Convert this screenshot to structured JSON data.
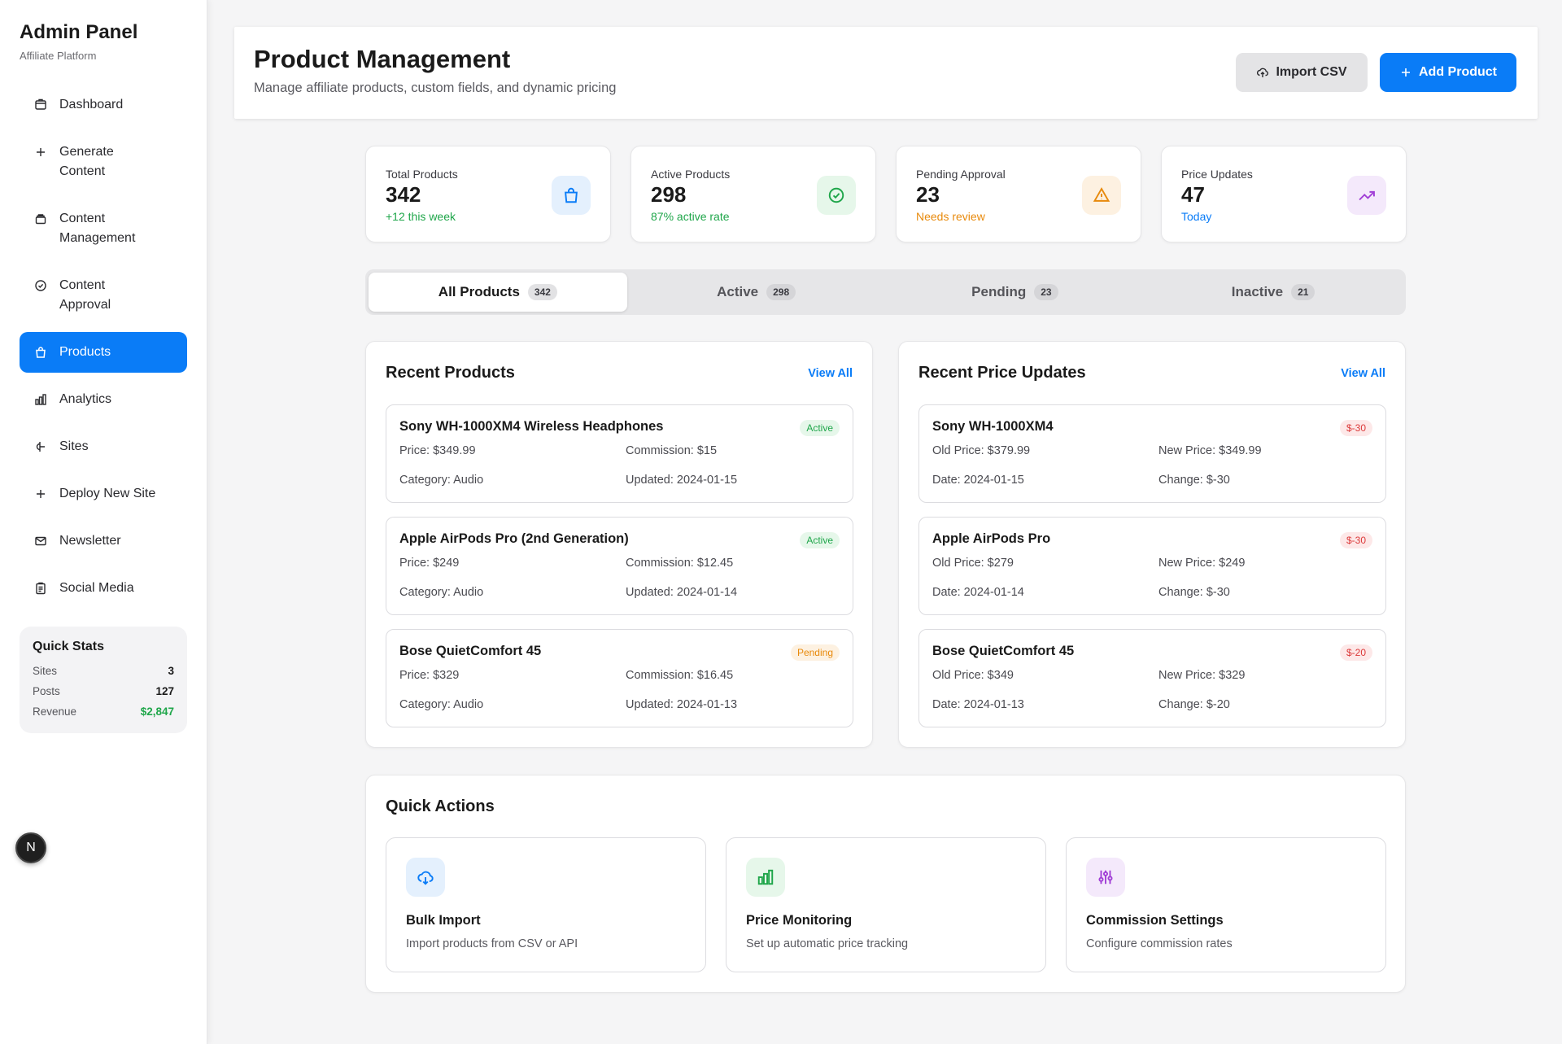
{
  "sidebar": {
    "title": "Admin Panel",
    "subtitle": "Affiliate Platform",
    "items": [
      {
        "label": "Dashboard",
        "icon": "dashboard-icon"
      },
      {
        "label": "Generate Content",
        "icon": "plus-icon"
      },
      {
        "label": "Content Management",
        "icon": "layers-icon"
      },
      {
        "label": "Content Approval",
        "icon": "check-circle-icon"
      },
      {
        "label": "Products",
        "icon": "shopping-bag-icon",
        "active": true
      },
      {
        "label": "Analytics",
        "icon": "bar-chart-icon"
      },
      {
        "label": "Sites",
        "icon": "git-branch-icon"
      },
      {
        "label": "Deploy New Site",
        "icon": "plus-icon"
      },
      {
        "label": "Newsletter",
        "icon": "mail-icon"
      },
      {
        "label": "Social Media",
        "icon": "clipboard-icon"
      }
    ],
    "quick_stats": {
      "title": "Quick Stats",
      "rows": [
        {
          "label": "Sites",
          "value": "3"
        },
        {
          "label": "Posts",
          "value": "127"
        },
        {
          "label": "Revenue",
          "value": "$2,847"
        }
      ]
    },
    "badge_letter": "N"
  },
  "header": {
    "title": "Product Management",
    "subtitle": "Manage affiliate products, custom fields, and dynamic pricing",
    "import_label": "Import CSV",
    "add_label": "Add Product"
  },
  "stats": [
    {
      "label": "Total Products",
      "value": "342",
      "sub": "+12 this week",
      "sub_color": "#1fa64a",
      "icon": "shopping-bag-icon",
      "icon_bg": "#e4f0fd",
      "icon_color": "#0a7cf7"
    },
    {
      "label": "Active Products",
      "value": "298",
      "sub": "87% active rate",
      "sub_color": "#1fa64a",
      "icon": "check-circle-icon",
      "icon_bg": "#e6f7ea",
      "icon_color": "#1fa64a"
    },
    {
      "label": "Pending Approval",
      "value": "23",
      "sub": "Needs review",
      "sub_color": "#e88a0c",
      "icon": "alert-triangle-icon",
      "icon_bg": "#fdf1e1",
      "icon_color": "#e88a0c"
    },
    {
      "label": "Price Updates",
      "value": "47",
      "sub": "Today",
      "sub_color": "#0a7cf7",
      "icon": "trending-up-icon",
      "icon_bg": "#f4e9fb",
      "icon_color": "#a13fd6"
    }
  ],
  "tabs": [
    {
      "label": "All Products",
      "count": "342",
      "active": true
    },
    {
      "label": "Active",
      "count": "298"
    },
    {
      "label": "Pending",
      "count": "23"
    },
    {
      "label": "Inactive",
      "count": "21"
    }
  ],
  "recent_products": {
    "title": "Recent Products",
    "view_all": "View All",
    "items": [
      {
        "name": "Sony WH-1000XM4 Wireless Headphones",
        "status": "Active",
        "price": "Price: $349.99",
        "commission": "Commission: $15",
        "category": "Category: Audio",
        "updated": "Updated: 2024-01-15"
      },
      {
        "name": "Apple AirPods Pro (2nd Generation)",
        "status": "Active",
        "price": "Price: $249",
        "commission": "Commission: $12.45",
        "category": "Category: Audio",
        "updated": "Updated: 2024-01-14"
      },
      {
        "name": "Bose QuietComfort 45",
        "status": "Pending",
        "price": "Price: $329",
        "commission": "Commission: $16.45",
        "category": "Category: Audio",
        "updated": "Updated: 2024-01-13"
      }
    ]
  },
  "recent_prices": {
    "title": "Recent Price Updates",
    "view_all": "View All",
    "items": [
      {
        "name": "Sony WH-1000XM4",
        "delta": "$-30",
        "old": "Old Price: $379.99",
        "new": "New Price: $349.99",
        "date": "Date: 2024-01-15",
        "change": "Change: $-30"
      },
      {
        "name": "Apple AirPods Pro",
        "delta": "$-30",
        "old": "Old Price: $279",
        "new": "New Price: $249",
        "date": "Date: 2024-01-14",
        "change": "Change: $-30"
      },
      {
        "name": "Bose QuietComfort 45",
        "delta": "$-20",
        "old": "Old Price: $349",
        "new": "New Price: $329",
        "date": "Date: 2024-01-13",
        "change": "Change: $-20"
      }
    ]
  },
  "quick_actions": {
    "title": "Quick Actions",
    "cards": [
      {
        "title": "Bulk Import",
        "desc": "Import products from CSV or API",
        "icon": "cloud-upload-icon",
        "icon_bg": "#e4f0fd",
        "icon_color": "#0a7cf7"
      },
      {
        "title": "Price Monitoring",
        "desc": "Set up automatic price tracking",
        "icon": "bar-chart-icon",
        "icon_bg": "#e6f7ea",
        "icon_color": "#1fa64a"
      },
      {
        "title": "Commission Settings",
        "desc": "Configure commission rates",
        "icon": "sliders-icon",
        "icon_bg": "#f4e9fb",
        "icon_color": "#a13fd6"
      }
    ]
  }
}
